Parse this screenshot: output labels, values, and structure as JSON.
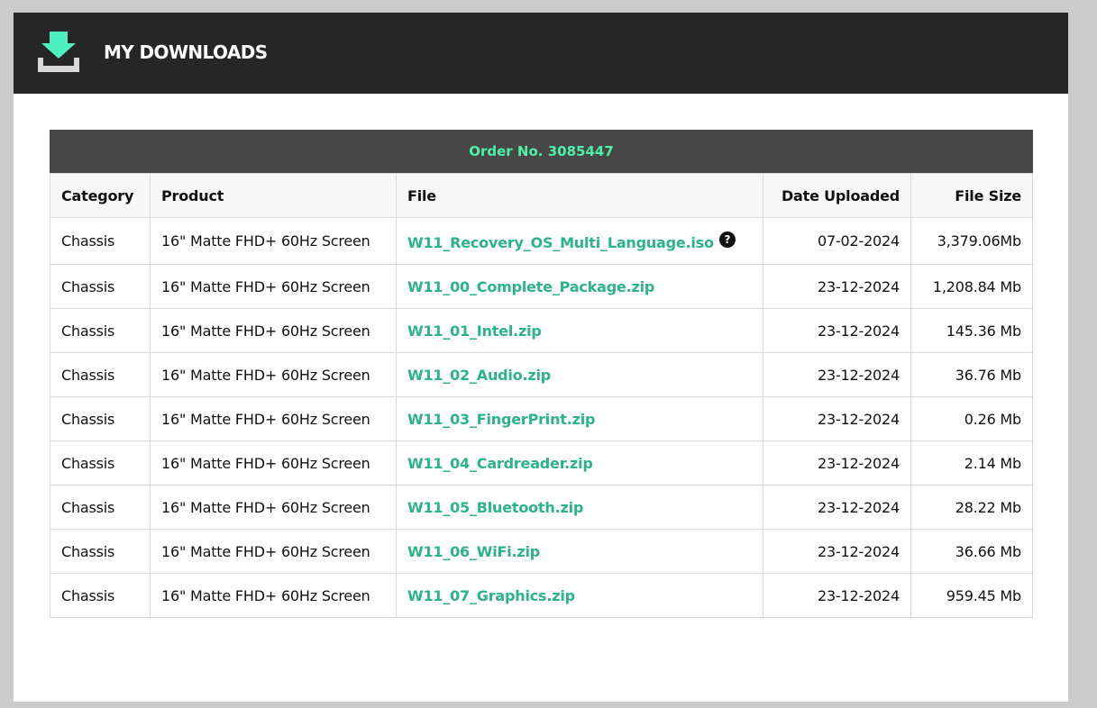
{
  "header": {
    "title": "MY DOWNLOADS",
    "icon": "download-icon",
    "icon_color": "#4ff0c0"
  },
  "order": {
    "title": "Order No. 3085447",
    "columns": [
      "Category",
      "Product",
      "File",
      "Date Uploaded",
      "File Size"
    ],
    "rows": [
      {
        "category": "Chassis",
        "product": "16\" Matte FHD+ 60Hz Screen",
        "file": "W11_Recovery_OS_Multi_Language.iso",
        "date": "07-02-2024",
        "size": "3,379.06Mb",
        "help": "?"
      },
      {
        "category": "Chassis",
        "product": "16\" Matte FHD+ 60Hz Screen",
        "file": "W11_00_Complete_Package.zip",
        "date": "23-12-2024",
        "size": "1,208.84 Mb"
      },
      {
        "category": "Chassis",
        "product": "16\" Matte FHD+ 60Hz Screen",
        "file": "W11_01_Intel.zip",
        "date": "23-12-2024",
        "size": "145.36 Mb"
      },
      {
        "category": "Chassis",
        "product": "16\" Matte FHD+ 60Hz Screen",
        "file": "W11_02_Audio.zip",
        "date": "23-12-2024",
        "size": "36.76 Mb"
      },
      {
        "category": "Chassis",
        "product": "16\" Matte FHD+ 60Hz Screen",
        "file": "W11_03_FingerPrint.zip",
        "date": "23-12-2024",
        "size": "0.26 Mb"
      },
      {
        "category": "Chassis",
        "product": "16\" Matte FHD+ 60Hz Screen",
        "file": "W11_04_Cardreader.zip",
        "date": "23-12-2024",
        "size": "2.14 Mb"
      },
      {
        "category": "Chassis",
        "product": "16\" Matte FHD+ 60Hz Screen",
        "file": "W11_05_Bluetooth.zip",
        "date": "23-12-2024",
        "size": "28.22 Mb"
      },
      {
        "category": "Chassis",
        "product": "16\" Matte FHD+ 60Hz Screen",
        "file": "W11_06_WiFi.zip",
        "date": "23-12-2024",
        "size": "36.66 Mb"
      },
      {
        "category": "Chassis",
        "product": "16\" Matte FHD+ 60Hz Screen",
        "file": "W11_07_Graphics.zip",
        "date": "23-12-2024",
        "size": "959.45 Mb"
      }
    ]
  },
  "colors": {
    "header_bg": "#262626",
    "order_bar_bg": "#474747",
    "order_title": "#4ff0a8",
    "link": "#2bb38a"
  }
}
